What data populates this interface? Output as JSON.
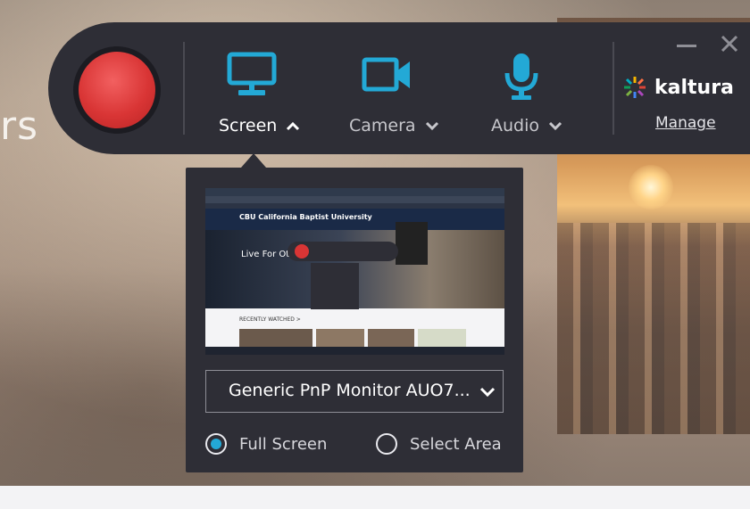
{
  "background": {
    "partial_heading": "rs",
    "preview_page": {
      "site_name": "CBU California Baptist University",
      "hero_text": "Live For Others",
      "section_label": "RECENTLY WATCHED >"
    }
  },
  "toolbar": {
    "record_icon": "record-icon",
    "sources": [
      {
        "label": "Screen",
        "icon": "monitor-icon",
        "chevron": "chevron-up-icon",
        "active": true
      },
      {
        "label": "Camera",
        "icon": "camera-icon",
        "chevron": "chevron-down-icon",
        "active": false
      },
      {
        "label": "Audio",
        "icon": "microphone-icon",
        "chevron": "chevron-down-icon",
        "active": false
      }
    ],
    "brand": "kaltura",
    "manage_label": "Manage",
    "window_controls": [
      "minimize-icon",
      "close-icon"
    ]
  },
  "screen_panel": {
    "monitor_select": {
      "value": "Generic PnP Monitor AUO7..."
    },
    "capture_modes": [
      {
        "label": "Full Screen",
        "selected": true
      },
      {
        "label": "Select Area",
        "selected": false
      }
    ]
  },
  "colors": {
    "toolbar_bg": "#2e2e36",
    "accent": "#23a9d6",
    "record": "#d93535"
  }
}
